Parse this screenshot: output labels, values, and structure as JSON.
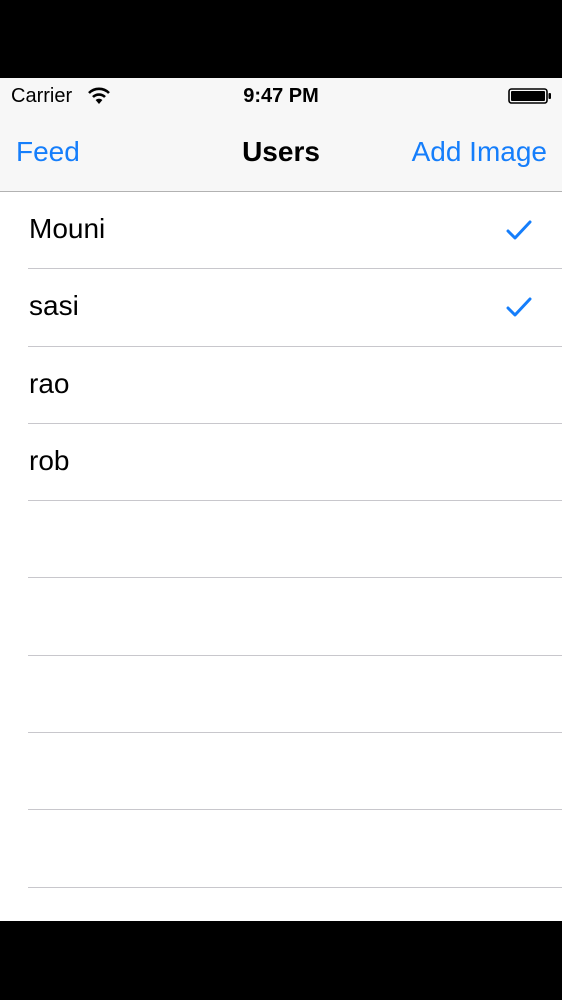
{
  "status_bar": {
    "carrier": "Carrier",
    "time": "9:47 PM",
    "wifi_icon": "wifi-icon",
    "battery_icon": "battery-icon"
  },
  "nav_bar": {
    "left_button": "Feed",
    "title": "Users",
    "right_button": "Add Image"
  },
  "accent_color": "#157efb",
  "users": [
    {
      "name": "Mouni",
      "checked": true
    },
    {
      "name": "sasi",
      "checked": true
    },
    {
      "name": "rao",
      "checked": false
    },
    {
      "name": "rob",
      "checked": false
    }
  ]
}
